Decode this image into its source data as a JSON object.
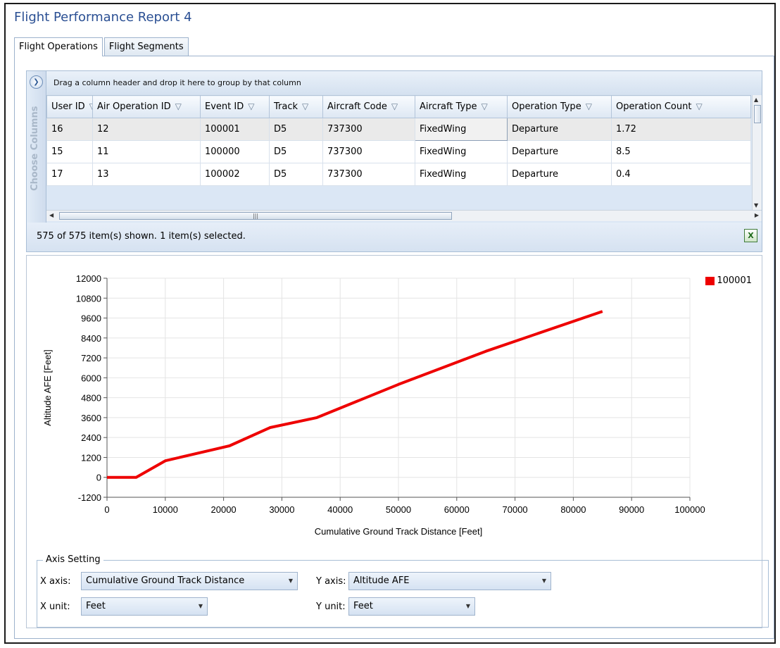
{
  "window": {
    "title": "Flight Performance Report 4"
  },
  "tabs": [
    {
      "label": "Flight Operations",
      "active": true
    },
    {
      "label": "Flight Segments",
      "active": false
    }
  ],
  "grid": {
    "side_label": "Choose Columns",
    "group_hint": "Drag a column header and drop it here to group by that column",
    "columns": [
      "User ID",
      "Air Operation ID",
      "Event ID",
      "Track",
      "Aircraft Code",
      "Aircraft Type",
      "Operation Type",
      "Operation Count"
    ],
    "rows": [
      [
        "16",
        "12",
        "100001",
        "D5",
        "737300",
        "FixedWing",
        "Departure",
        "1.72"
      ],
      [
        "15",
        "11",
        "100000",
        "D5",
        "737300",
        "FixedWing",
        "Departure",
        "8.5"
      ],
      [
        "17",
        "13",
        "100002",
        "D5",
        "737300",
        "FixedWing",
        "Departure",
        "0.4"
      ]
    ],
    "status": "575 of 575 item(s) shown. 1 item(s) selected."
  },
  "chart_data": {
    "type": "line",
    "title": "",
    "xlabel": "Cumulative Ground Track Distance [Feet]",
    "ylabel": "Altitude AFE [Feet]",
    "xlim": [
      0,
      100000
    ],
    "ylim": [
      -1200,
      12000
    ],
    "x_ticks": [
      0,
      10000,
      20000,
      30000,
      40000,
      50000,
      60000,
      70000,
      80000,
      90000,
      100000
    ],
    "y_ticks": [
      -1200,
      0,
      1200,
      2400,
      3600,
      4800,
      6000,
      7200,
      8400,
      9600,
      10800,
      12000
    ],
    "grid": true,
    "legend_position": "top-right",
    "series": [
      {
        "name": "100001",
        "color": "#ee0000",
        "x": [
          0,
          5000,
          10000,
          21000,
          28000,
          36000,
          50000,
          65000,
          85000
        ],
        "y": [
          0,
          0,
          1000,
          1900,
          3000,
          3600,
          5600,
          7600,
          10000
        ]
      }
    ]
  },
  "axis_setting": {
    "title": "Axis Setting",
    "x_axis_label": "X axis:",
    "x_axis_value": "Cumulative Ground Track Distance",
    "y_axis_label": "Y axis:",
    "y_axis_value": "Altitude AFE",
    "x_unit_label": "X unit:",
    "x_unit_value": "Feet",
    "y_unit_label": "Y unit:",
    "y_unit_value": "Feet"
  }
}
